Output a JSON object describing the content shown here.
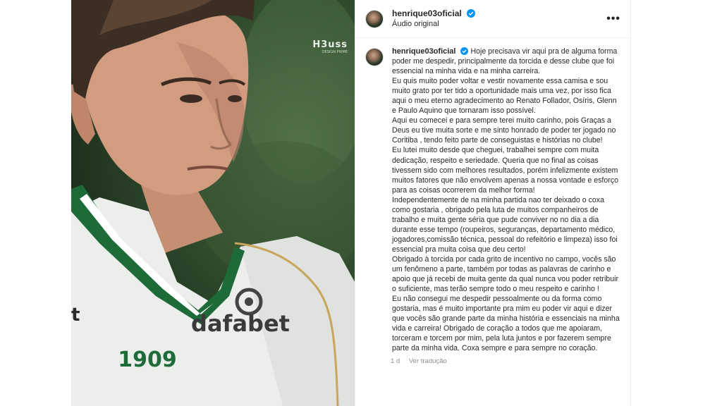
{
  "post": {
    "watermark": "H3uss",
    "watermark_sub": "DESIGN PRIME",
    "shirt_sponsor": "dafabet",
    "shirt_number": "1909",
    "shirt_letter": "t"
  },
  "header": {
    "username": "henrique03oficial",
    "subtitle": "Áudio original",
    "more_label": "•••"
  },
  "caption": {
    "username": "henrique03oficial",
    "paragraphs": [
      "Hoje precisava vir aqui pra de alguma forma poder me despedir, principalmente da torcida e desse clube que foi essencial na minha vida e na minha carreira.",
      "Eu quis muito poder voltar e vestir novamente essa camisa e sou muito grato por ter tido a oportunidade mais uma vez, por isso fica aqui o meu eterno agradecimento ao Renato Follador, Osíris, Glenn e Paulo Aquino que tornaram isso possível.",
      "Aqui eu comecei e para sempre terei muito carinho, pois Graças a Deus eu tive muita sorte e me sinto honrado de poder ter jogado no Coritiba , tendo feito parte de conseguistas e histórias no clube!",
      "Eu lutei muito desde que cheguei, trabalhei sempre com muita dedicação, respeito e seriedade. Queria que no final as coisas tivessem sido com melhores resultados, porém infelizmente existem muitos fatores que não envolvem apenas a nossa vontade e esforço para as coisas ocorrerem da melhor forma!",
      "Independentemente de na minha partida nao ter deixado o coxa como gostaria , obrigado pela luta de muitos companheiros de trabalho e muita gente séria que pude conviver no no dia a dia durante esse tempo (roupeiros, seguranças, departamento médico, jogadores,comissão técnica, pessoal do refeitório e limpeza) isso foi essencial pra muita coisa que deu certo!",
      "Obrigado à torcida por cada grito de incentivo no campo, vocês são um fenômeno a parte, também por todas as palavras de carinho e apoio que já recebi de muita gente da qual nunca vou poder retribuir o suficiente, mas terão sempre todo o meu respeito e carinho !",
      "Eu não consegui me despedir pessoalmente ou da forma como gostaria, mas é muito importante pra mim eu poder vir aqui e dizer que vocês são grande parte da minha história e essenciais na minha vida e carreira! Obrigado de coração a todos que me apoiaram, torceram e torcem por mim, pela luta juntos e por fazerem sempre parte da minha vida. Coxa sempre e para sempre no coração."
    ]
  },
  "meta": {
    "time": "1 d",
    "translate": "Ver tradução"
  },
  "colors": {
    "verified": "#0095f6",
    "jersey_green": "#1e6b3a",
    "text": "#262626",
    "muted": "#8e8e8e"
  }
}
